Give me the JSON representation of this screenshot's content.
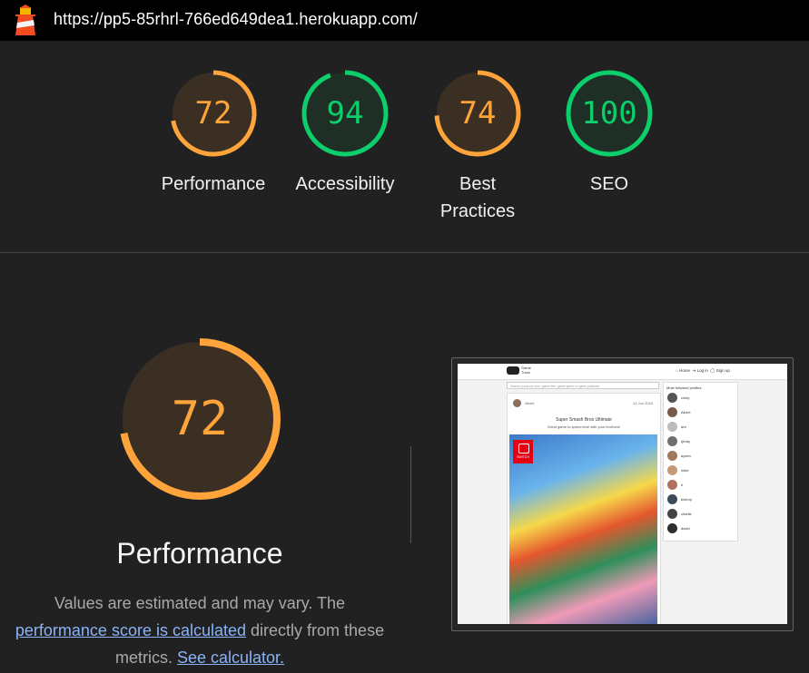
{
  "topbar": {
    "url": "https://pp5-85rhrl-766ed649dea1.herokuapp.com/"
  },
  "gauges": [
    {
      "label": "Performance",
      "score": "72",
      "value": 72,
      "status": "average"
    },
    {
      "label": "Accessibility",
      "score": "94",
      "value": 94,
      "status": "pass"
    },
    {
      "label": "Best Practices",
      "label_line1": "Best",
      "label_line2": "Practices",
      "score": "74",
      "value": 74,
      "status": "average"
    },
    {
      "label": "SEO",
      "score": "100",
      "value": 100,
      "status": "pass"
    }
  ],
  "colors": {
    "average": "#ffa43a",
    "average_bg": "#3b2f23",
    "pass": "#0cce6b",
    "pass_bg": "#1f2f25",
    "link": "#8ab4f8",
    "background": "#212121"
  },
  "performance": {
    "title": "Performance",
    "score": "72",
    "value": 72,
    "desc_1": "Values are estimated and may vary. The",
    "link_1": "performance score is calculated",
    "desc_2": "directly from these",
    "desc_3": "metrics.",
    "link_2": "See calculator."
  },
  "thumbnail": {
    "logo_text_1": "Game",
    "logo_text_2": "Track",
    "nav_home": "Home",
    "nav_login": "Log in",
    "nav_signup": "Sign up",
    "search_placeholder": "Search posts by user, game title, game genre or game platform",
    "post_owner": "Albert",
    "post_date": "11 Jun 2024",
    "post_title": "Super Smash Bros Ultimate",
    "post_subtitle": "Great game to spend time with your brothers!",
    "badge_text": "SWITCH",
    "sidebar_title": "Most followed profiles",
    "profiles": [
      "cindy",
      "Albert",
      "ant",
      "rjbray",
      "ayden",
      "mike",
      "ri",
      "bishop",
      "charlie",
      "david"
    ]
  },
  "icons": {
    "logo": "lighthouse-icon"
  }
}
